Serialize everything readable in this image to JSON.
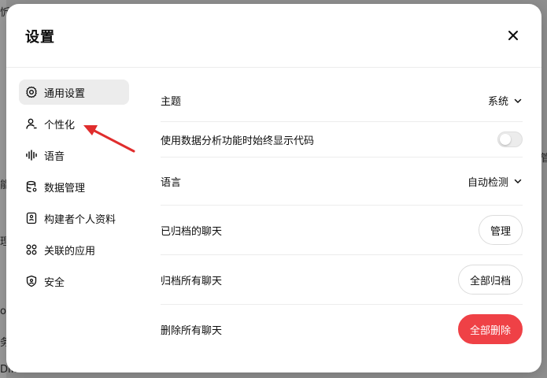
{
  "background": {
    "fragments": [
      "忻",
      "管",
      "能",
      "理",
      "og",
      "务",
      "Differences"
    ]
  },
  "modal": {
    "title": "设置",
    "close_icon": "close-icon"
  },
  "sidebar": {
    "items": [
      {
        "label": "通用设置",
        "icon": "gear-icon",
        "active": true
      },
      {
        "label": "个性化",
        "icon": "person-icon",
        "active": false
      },
      {
        "label": "语音",
        "icon": "waveform-icon",
        "active": false
      },
      {
        "label": "数据管理",
        "icon": "database-icon",
        "active": false
      },
      {
        "label": "构建者个人资料",
        "icon": "id-card-icon",
        "active": false
      },
      {
        "label": "关联的应用",
        "icon": "grid-icon",
        "active": false
      },
      {
        "label": "安全",
        "icon": "shield-icon",
        "active": false
      }
    ]
  },
  "settings": {
    "theme": {
      "label": "主题",
      "value": "系统"
    },
    "show_code": {
      "label": "使用数据分析功能时始终显示代码",
      "enabled": false
    },
    "language": {
      "label": "语言",
      "value": "自动检测"
    },
    "archived": {
      "label": "已归档的聊天",
      "button": "管理"
    },
    "archive_all": {
      "label": "归档所有聊天",
      "button": "全部归档"
    },
    "delete_all": {
      "label": "删除所有聊天",
      "button": "全部删除"
    }
  },
  "colors": {
    "danger": "#ef4146",
    "annotation_arrow": "#e02d2d",
    "active_bg": "#ececec"
  }
}
